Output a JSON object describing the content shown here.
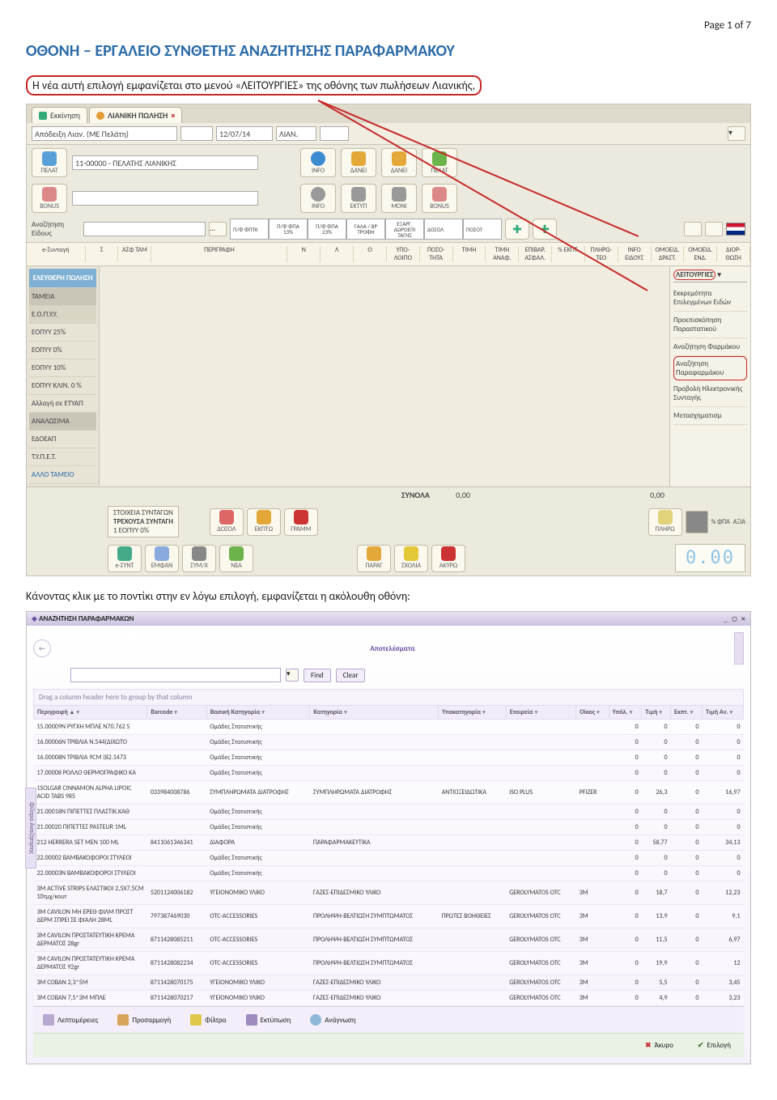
{
  "page_number": "Page 1 of 7",
  "doc_title": "ΟΘΟΝΗ – ΕΡΓΑΛΕΙΟ ΣΥΝΘΕΤΗΣ ΑΝΑΖΗΤΗΣΗΣ ΠΑΡΑΦΑΡΜΑΚΟΥ",
  "intro": "Η νέα αυτή επιλογή εμφανίζεται στο μενού «ΛΕΙΤΟΥΡΓΙΕΣ» της οθόνης των πωλήσεων Λιανικής,",
  "shot1": {
    "tab1": "Εκκίνηση",
    "tab2": "ΛΙΑΝΙΚΗ ΠΩΛΗΣΗ",
    "doc_type": "Απόδειξη Λιαν. (ΜΕ Πελάτη)",
    "date": "12/07/14",
    "kind": "ΛΙΑΝ.",
    "customer": "11-00000 - ΠΕΛΑΤΗΣ ΛΙΑΝΙΚΗΣ",
    "btns_row1": [
      "ΠΕΛΑΤ",
      "INFO",
      "ΔΑΝΕΙ",
      "ΔΑΝΕΙ",
      "ΠΕΛΑΤ"
    ],
    "btns_row2": [
      "BONUS",
      "INFO",
      "ΕΚΤΥΠ",
      "ΜΟΝΙ",
      "BONUS"
    ],
    "search_lbl": "Αναζήτηση Είδους",
    "mini_cols": [
      "Π/Φ ΦΠΤΚ",
      "Π/Φ ΦΠΑ 13%",
      "Π/Φ ΦΠΑ 23%",
      "ΓΑΛΑ / ΒΡ ΤΡΟΦΗ",
      "ΕΞΑΡΓ. ΔΩΡΟΕΠΙ ΤΑΓΗΣ",
      "ΔΟΣΟΛ",
      "ΠΟΣΟΤ"
    ],
    "grid_cols": [
      "e-Συνταγή",
      "Σ",
      "ΑΣΦ ΤΑΜ",
      "ΠΕΡΙΓΡΑΦΗ",
      "Ν",
      "Λ",
      "Ο",
      "ΥΠΟ- ΛΟΙΠΟ",
      "ΠΟΣΟ- ΤΗΤΑ",
      "ΤΙΜΗ",
      "ΤΙΜΗ ΑΝΑΦ.",
      "ΕΠΙΒΑΡ. ΑΣΦΑΛ.",
      "% ΕΚΠΤ.",
      "ΠΛΗΡΩ- ΤΕΟ",
      "INFO ΕΙΔΟΥΣ",
      "ΟΜΟΕΙΔ. ΔΡΑΣΤ.",
      "ΟΜΟΕΙΔ. ΕΝΔ.",
      "ΔΙΟΡ- ΘΩΣΗ"
    ],
    "left_items": [
      "ΕΛΕΥΘΕΡΗ ΠΩΛΗΣΗ",
      "ΤΑΜΕΙΑ",
      "Ε.Ο.Π.Υ.Υ.",
      "ΕΟΠΥΥ 25%",
      "ΕΟΠΥΥ 0%",
      "ΕΟΠΥΥ 10%",
      "ΕΟΠΥΥ ΚΛΙΝ. 0 %",
      "Αλλαγή σε ΕΤΥΑΠ",
      "ΑΝΑΛΩΣΙΜΑ",
      "ΕΔΟΕΑΠ",
      "Τ.Υ.Π.Ε.Τ.",
      "ΑΛΛΟ ΤΑΜΕΙΟ"
    ],
    "right_hdr": "ΛΕΙΤΟΥΡΓΙΕΣ",
    "right_items": [
      "Εκκρεμότητα Επιλεγμένων Ειδών",
      "Προεπισκόπηση Παραστατικού",
      "Αναζήτηση Φαρμάκου",
      "Αναζήτηση Παραφαρμάκου",
      "Προβολή Ηλεκτρονικής Συνταγής",
      "Μετασχηματισμ"
    ],
    "totals_lbl": "ΣΥΝΟΛΑ",
    "totals_v1": "0,00",
    "totals_v2": "0,00",
    "recipe_box_l1": "ΣΤΟΙΧΕΙΑ ΣΥΝΤΑΓΩΝ",
    "recipe_box_l2": "ΤΡΕΧΟΥΣΑ ΣΥΝΤΑΓΗ",
    "recipe_box_l3": "1   ΕΟΠΥΥ   0%",
    "bot_btns_left": [
      "e-ΣΥΝΤ",
      "ΕΜΦΑΝ",
      "ΣΥΜ/Χ",
      "ΝΕΑ"
    ],
    "bot_btns_mid": [
      "ΔΟΣΟΛ",
      "ΕΚΠΤΩ",
      "ΓΡΑΜΜ",
      "ΠΑΡΑΓ",
      "ΣΧΟΛΙΑ",
      "ΑΚΥΡΩ"
    ],
    "bot_right": [
      "ΠΛΗΡΩ",
      "% ΦΠΑ",
      "ΑΞΙΑ"
    ],
    "display": "0.00"
  },
  "caption2": "Κάνοντας κλικ με το ποντίκι στην εν λόγω επιλογή, εμφανίζεται η ακόλουθη οθόνη:",
  "shot2": {
    "wintitle": "ΑΝΑΖΗΤΗΣΗ ΠΑΡΑΦΑΡΜΑΚΩΝ",
    "results_hdr": "Αποτελέσματα",
    "find": "Find",
    "clear": "Clear",
    "grp_hint": "Drag a column header here to group by that column",
    "vtab": "Φίλτρα Αναζήτησης",
    "cols": [
      "Περιγραφή",
      "Barcode",
      "Βασική Κατηγορία",
      "Κατηγορία",
      "Υποκατηγορία",
      "Εταιρεία",
      "Οίκος",
      "Υπόλ.",
      "Τιμή",
      "Εκπτ.",
      "Τιμή Αν."
    ],
    "rows": [
      {
        "desc": "15.00009Ν ΡΥΓΧΗ ΜΠΛΕ Ν70.762 S",
        "bc": "",
        "bcat": "Ομάδες Στατιστικής",
        "cat": "",
        "sub": "",
        "comp": "",
        "house": "",
        "stock": "0",
        "price": "0",
        "disc": "0",
        "pav": "0"
      },
      {
        "desc": "16.00006Ν ΤΡΙΒΛΙΑ Ν.544(ΔΙΧΩΤΟ",
        "bc": "",
        "bcat": "Ομάδες Στατιστικής",
        "cat": "",
        "sub": "",
        "comp": "",
        "house": "",
        "stock": "0",
        "price": "0",
        "disc": "0",
        "pav": "0"
      },
      {
        "desc": "16.00008Ν ΤΡΙΒΛΙΑ 9CM (82.1473",
        "bc": "",
        "bcat": "Ομάδες Στατιστικής",
        "cat": "",
        "sub": "",
        "comp": "",
        "house": "",
        "stock": "0",
        "price": "0",
        "disc": "0",
        "pav": "0"
      },
      {
        "desc": "17.00008 ΡΟΛΛΟ ΘΕΡΜΟΓΡΑΦΙΚΟ ΚΑ",
        "bc": "",
        "bcat": "Ομάδες Στατιστικής",
        "cat": "",
        "sub": "",
        "comp": "",
        "house": "",
        "stock": "0",
        "price": "0",
        "disc": "0",
        "pav": "0"
      },
      {
        "desc": "1SOLGAR CINNAMON ALPHA LIPOIC ACID TABS 985",
        "bc": "033984008786",
        "bcat": "ΣΥΜΠΛΗΡΩΜΑΤΑ ΔΙΑΤΡΟΦΗΣ",
        "cat": "ΣΥΜΠΛΗΡΩΜΑΤΑ ΔΙΑΤΡΟΦΗΣ",
        "sub": "ΑΝΤΙΟΞΕΙΔΩΤΙΚΑ",
        "comp": "ISO PLUS",
        "house": "PFIZER",
        "stock": "0",
        "price": "26,3",
        "disc": "0",
        "pav": "16,97"
      },
      {
        "desc": "21.00018Ν ΠΙΠΕΤΤΕΣ ΠΛΑΣΤΙΚ.ΚΑΘ",
        "bc": "",
        "bcat": "Ομάδες Στατιστικής",
        "cat": "",
        "sub": "",
        "comp": "",
        "house": "",
        "stock": "0",
        "price": "0",
        "disc": "0",
        "pav": "0"
      },
      {
        "desc": "21.00020 ΠΙΠΕΤΤΕΣ PASTEUR 1ML",
        "bc": "",
        "bcat": "Ομάδες Στατιστικής",
        "cat": "",
        "sub": "",
        "comp": "",
        "house": "",
        "stock": "0",
        "price": "0",
        "disc": "0",
        "pav": "0"
      },
      {
        "desc": "212 HERRERA SET MEN 100 ML",
        "bc": "8411061346341",
        "bcat": "ΔΙΑΦΟΡΑ",
        "cat": "ΠΑΡΑΦΑΡΜΑΚΕΥΤΙΚΑ",
        "sub": "",
        "comp": "",
        "house": "",
        "stock": "0",
        "price": "58,77",
        "disc": "0",
        "pav": "34,13"
      },
      {
        "desc": "22.00002 ΒΑΜΒΑΚΟΦΟΡΟΙ ΣΤΥΛΕΟΙ",
        "bc": "",
        "bcat": "Ομάδες Στατιστικής",
        "cat": "",
        "sub": "",
        "comp": "",
        "house": "",
        "stock": "0",
        "price": "0",
        "disc": "0",
        "pav": "0"
      },
      {
        "desc": "22.00003Ν ΒΑΜΒΑΚΟΦΟΡΟΙ ΣΤΥΛΕΟΙ",
        "bc": "",
        "bcat": "Ομάδες Στατιστικής",
        "cat": "",
        "sub": "",
        "comp": "",
        "house": "",
        "stock": "0",
        "price": "0",
        "disc": "0",
        "pav": "0"
      },
      {
        "desc": "3M ACTIVE STRIPS ΕΛΑΣΤΙΚΟΙ 2,5X7,5CM 10τμχ/κουτ",
        "bc": "5201124006182",
        "bcat": "ΥΓΕΙΟΝΟΜΙΚΟ ΥΛΙΚΟ",
        "cat": "ΓΑΖΕΣ-ΕΠΙΔΕΣΜΙΚΟ ΥΛΙΚΟ",
        "sub": "",
        "comp": "GEROLYMATOS OTC",
        "house": "3M",
        "stock": "0",
        "price": "18,7",
        "disc": "0",
        "pav": "12,23"
      },
      {
        "desc": "3M CAVILON ΜΗ ΕΡΕΘ ΦΙΛΜ ΠΡΟΣΤ ΔΕΡΜ ΣΠΡΕΙ ΣΕ ΦΙΑΛΗ 28ML",
        "bc": "797387469030",
        "bcat": "OTC-ACCESSORIES",
        "cat": "ΠΡΟΛΗΨΗ-ΒΕΛΤΙΩΣΗ ΣΥΜΠΤΩΜΑΤΟΣ",
        "sub": "ΠΡΩΤΕΣ ΒΟΗΘΕΙΕΣ",
        "comp": "GEROLYMATOS OTC",
        "house": "3M",
        "stock": "0",
        "price": "13,9",
        "disc": "0",
        "pav": "9,1"
      },
      {
        "desc": "3M CAVILON ΠΡΟΣΤΑΤΕΥΤΙΚΗ ΚΡΕΜΑ ΔΕΡΜΑΤΟΣ 28gr",
        "bc": "8711428085211",
        "bcat": "OTC-ACCESSORIES",
        "cat": "ΠΡΟΛΗΨΗ-ΒΕΛΤΙΩΣΗ ΣΥΜΠΤΩΜΑΤΟΣ",
        "sub": "",
        "comp": "GEROLYMATOS OTC",
        "house": "3M",
        "stock": "0",
        "price": "11,5",
        "disc": "0",
        "pav": "6,97"
      },
      {
        "desc": "3M CAVILON ΠΡΟΣΤΑΤΕΥΤΙΚΗ ΚΡΕΜΑ ΔΕΡΜΑΤΟΣ 92gr",
        "bc": "8711428082234",
        "bcat": "OTC-ACCESSORIES",
        "cat": "ΠΡΟΛΗΨΗ-ΒΕΛΤΙΩΣΗ ΣΥΜΠΤΩΜΑΤΟΣ",
        "sub": "",
        "comp": "GEROLYMATOS OTC",
        "house": "3M",
        "stock": "0",
        "price": "19,9",
        "disc": "0",
        "pav": "12"
      },
      {
        "desc": "3M COBAN 2,3*5M",
        "bc": "8711428070175",
        "bcat": "ΥΓΕΙΟΝΟΜΙΚΟ ΥΛΙΚΟ",
        "cat": "ΓΑΖΕΣ-ΕΠΙΔΕΣΜΙΚΟ ΥΛΙΚΟ",
        "sub": "",
        "comp": "GEROLYMATOS OTC",
        "house": "3M",
        "stock": "0",
        "price": "5,5",
        "disc": "0",
        "pav": "3,45"
      },
      {
        "desc": "3M COBAN 7,5*3M ΜΠΛΕ",
        "bc": "8711428070217",
        "bcat": "ΥΓΕΙΟΝΟΜΙΚΟ ΥΛΙΚΟ",
        "cat": "ΓΑΖΕΣ-ΕΠΙΔΕΣΜΙΚΟ ΥΛΙΚΟ",
        "sub": "",
        "comp": "GEROLYMATOS OTC",
        "house": "3M",
        "stock": "0",
        "price": "4,9",
        "disc": "0",
        "pav": "3,23"
      }
    ],
    "bottom_btns": [
      "Λεπτομέρειες",
      "Προσαρμογή",
      "Φίλτρα",
      "Εκτύπωση",
      "Ανάγνωση"
    ],
    "cancel": "Άκυρο",
    "select": "Επιλογή"
  }
}
